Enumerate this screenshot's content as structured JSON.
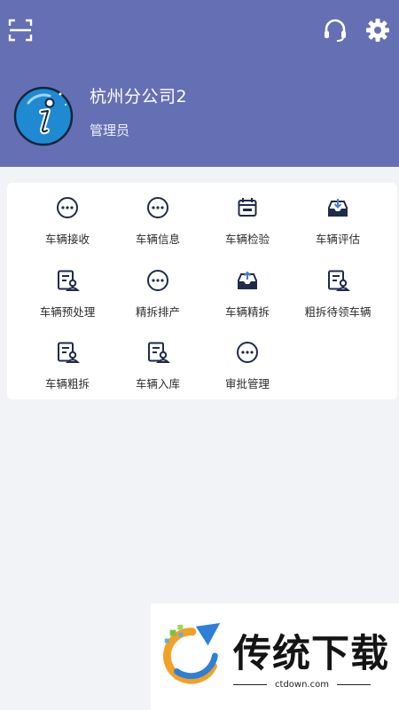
{
  "header": {
    "company": "杭州分公司2",
    "role": "管理员",
    "color": "#6570b4"
  },
  "icons": {
    "scan": "scan-icon",
    "support": "headset-icon",
    "settings": "gear-icon",
    "avatar": "info-avatar-icon"
  },
  "menu": {
    "items": [
      {
        "label": "车辆接收",
        "icon": "more-circle-icon"
      },
      {
        "label": "车辆信息",
        "icon": "more-circle-icon"
      },
      {
        "label": "车辆检验",
        "icon": "calendar-icon"
      },
      {
        "label": "车辆评估",
        "icon": "inbox-download-icon"
      },
      {
        "label": "车辆预处理",
        "icon": "user-document-icon"
      },
      {
        "label": "精拆排产",
        "icon": "more-circle-icon"
      },
      {
        "label": "车辆精拆",
        "icon": "inbox-upload-icon"
      },
      {
        "label": "粗拆待领车辆",
        "icon": "user-document-icon"
      },
      {
        "label": "车辆粗拆",
        "icon": "user-document-icon"
      },
      {
        "label": "车辆入库",
        "icon": "user-document-icon"
      },
      {
        "label": "审批管理",
        "icon": "more-circle-icon"
      }
    ]
  },
  "watermark": {
    "title": "传统下载",
    "site": "ctdown.com"
  }
}
